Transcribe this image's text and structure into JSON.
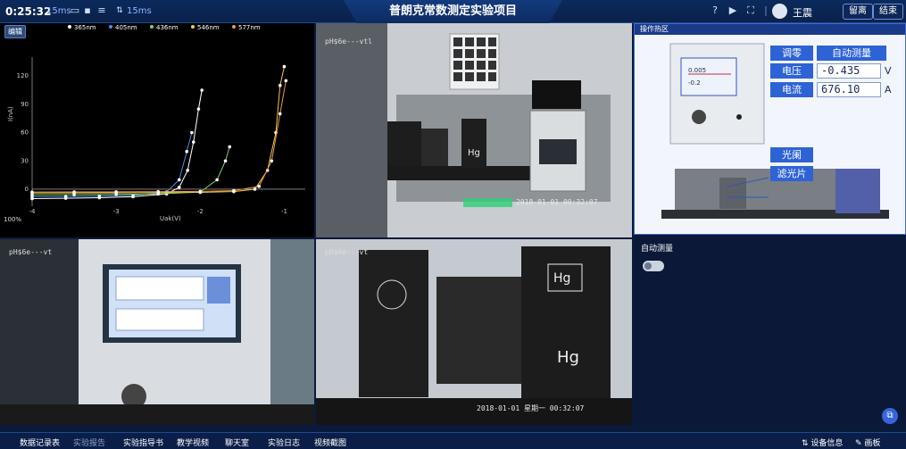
{
  "header": {
    "timer": "0:25:32",
    "latency1": "15ms",
    "latency2": "15ms",
    "title": "普朗克常数测定实验项目",
    "user_name": "王震",
    "leave_label": "留离",
    "end_label": "结束"
  },
  "chart_panel": {
    "edit_label": "编辑",
    "zoom": "100%"
  },
  "chart_data": {
    "type": "scatter",
    "series": [
      {
        "name": "365nm",
        "color": "#ffffff",
        "x": [
          -4.0,
          -3.6,
          -3.2,
          -2.8,
          -2.4,
          -2.25,
          -2.15,
          -2.08,
          -2.02,
          -1.98
        ],
        "y": [
          -10,
          -9.6,
          -9,
          -8,
          -5,
          2,
          20,
          50,
          85,
          105
        ]
      },
      {
        "name": "405nm",
        "color": "#4f8be8",
        "x": [
          -4.0,
          -3.6,
          -3.2,
          -2.8,
          -2.4,
          -2.25,
          -2.16,
          -2.1
        ],
        "y": [
          -8,
          -7.8,
          -7.4,
          -6.5,
          -3,
          10,
          40,
          60
        ]
      },
      {
        "name": "436nm",
        "color": "#7ad36b",
        "x": [
          -4.0,
          -3.5,
          -3.0,
          -2.5,
          -2.0,
          -1.8,
          -1.7,
          -1.65
        ],
        "y": [
          -6,
          -5.8,
          -5.5,
          -5,
          -3,
          10,
          30,
          45
        ]
      },
      {
        "name": "546nm",
        "color": "#f2c94c",
        "x": [
          -4.0,
          -3.5,
          -3.0,
          -2.5,
          -2.0,
          -1.6,
          -1.35,
          -1.2,
          -1.1,
          -1.05,
          -1.0
        ],
        "y": [
          -4,
          -3.9,
          -3.8,
          -3.6,
          -3.3,
          -2.5,
          0,
          20,
          60,
          110,
          130
        ]
      },
      {
        "name": "577nm",
        "color": "#f2994a",
        "x": [
          -4.0,
          -3.5,
          -3.0,
          -2.5,
          -2.0,
          -1.6,
          -1.3,
          -1.15,
          -1.05,
          -0.98
        ],
        "y": [
          -3,
          -2.9,
          -2.8,
          -2.6,
          -2.3,
          -1.5,
          3,
          30,
          80,
          115
        ]
      }
    ],
    "xlabel": "Uak(V)",
    "ylabel": "I(nA)",
    "x_ticks": [
      -4,
      -3,
      -2,
      -1
    ],
    "y_ticks": [
      0,
      30,
      60,
      90,
      120
    ],
    "xlim": [
      -4.0,
      -0.75
    ],
    "ylim": [
      -18,
      140
    ],
    "grid": false,
    "legend": "top"
  },
  "cameras": {
    "cam1_label": "pH$6e---vtl",
    "cam1_time": "2018-01-01   00:32:07",
    "cam2_label": "pH$6e---vt",
    "cam3_label": "pH$6e---vt",
    "cam3_time": "2018-01-01   星期一   00:32:07"
  },
  "operation_panel": {
    "header": "操作热区",
    "zero_label": "调零",
    "auto_label": "自动测量",
    "voltage_label": "电压",
    "voltage_value": "-0.435",
    "voltage_unit": "V",
    "current_label": "电流",
    "current_value": "676.10",
    "current_unit": "A",
    "aperture_label": "光阑",
    "filter_label": "滤光片",
    "screen_v1": "0.005",
    "screen_v2": "-0.2"
  },
  "auto_measure": {
    "label": "自动测量"
  },
  "footer": {
    "items": [
      {
        "label": "数据记录表",
        "dim": false
      },
      {
        "label": "实验报告",
        "dim": true
      },
      {
        "label": "实验指导书",
        "dim": false
      },
      {
        "label": "教学视频",
        "dim": false
      },
      {
        "label": "聊天室",
        "dim": false
      },
      {
        "label": "实验日志",
        "dim": false
      },
      {
        "label": "视频截图",
        "dim": false
      }
    ],
    "device_info": "设备信息",
    "draw_label": "画板"
  }
}
